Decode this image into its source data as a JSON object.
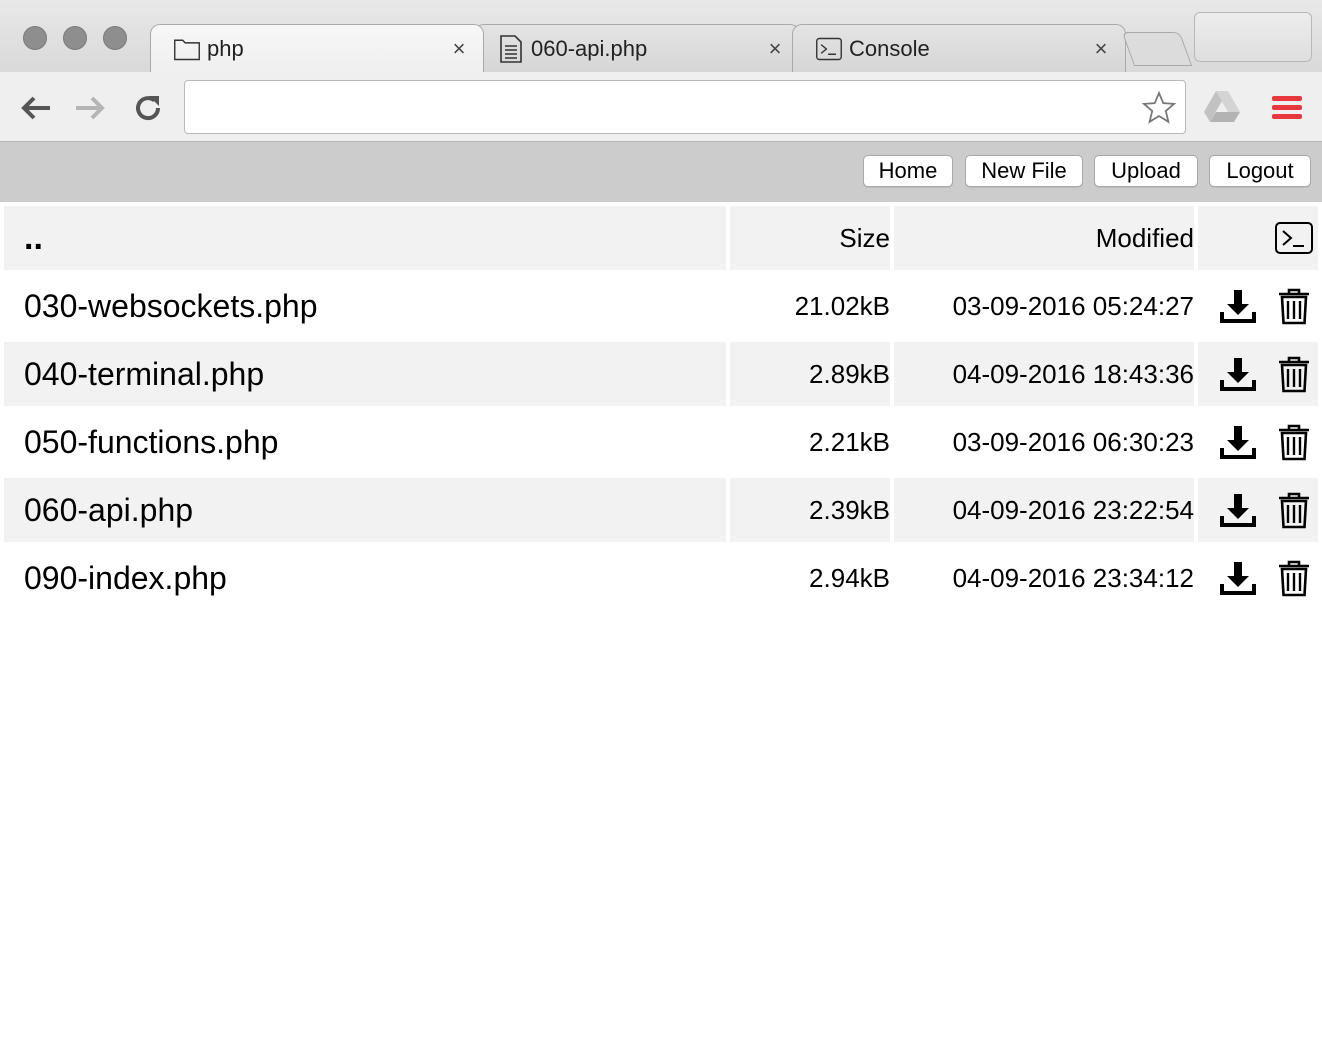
{
  "browser": {
    "tabs": [
      {
        "title": "php",
        "icon": "folder-icon",
        "active": true
      },
      {
        "title": "060-api.php",
        "icon": "document-icon",
        "active": false
      },
      {
        "title": "Console",
        "icon": "terminal-icon",
        "active": false
      }
    ],
    "tab_close_glyph": "×",
    "address_bar": {
      "value": "",
      "placeholder": ""
    }
  },
  "header": {
    "buttons": {
      "home": "Home",
      "new_file": "New File",
      "upload": "Upload",
      "logout": "Logout"
    }
  },
  "table": {
    "parent_dir": "..",
    "columns": {
      "size": "Size",
      "modified": "Modified"
    },
    "rows": [
      {
        "name": "030-websockets.php",
        "size": "21.02kB",
        "modified": "03-09-2016 05:24:27"
      },
      {
        "name": "040-terminal.php",
        "size": "2.89kB",
        "modified": "04-09-2016 18:43:36"
      },
      {
        "name": "050-functions.php",
        "size": "2.21kB",
        "modified": "03-09-2016 06:30:23"
      },
      {
        "name": "060-api.php",
        "size": "2.39kB",
        "modified": "04-09-2016 23:22:54"
      },
      {
        "name": "090-index.php",
        "size": "2.94kB",
        "modified": "04-09-2016 23:34:12"
      }
    ]
  },
  "colors": {
    "appbar": "#cccccc",
    "row_shade": "#f2f2f2",
    "menu_red": "#e8383d"
  }
}
